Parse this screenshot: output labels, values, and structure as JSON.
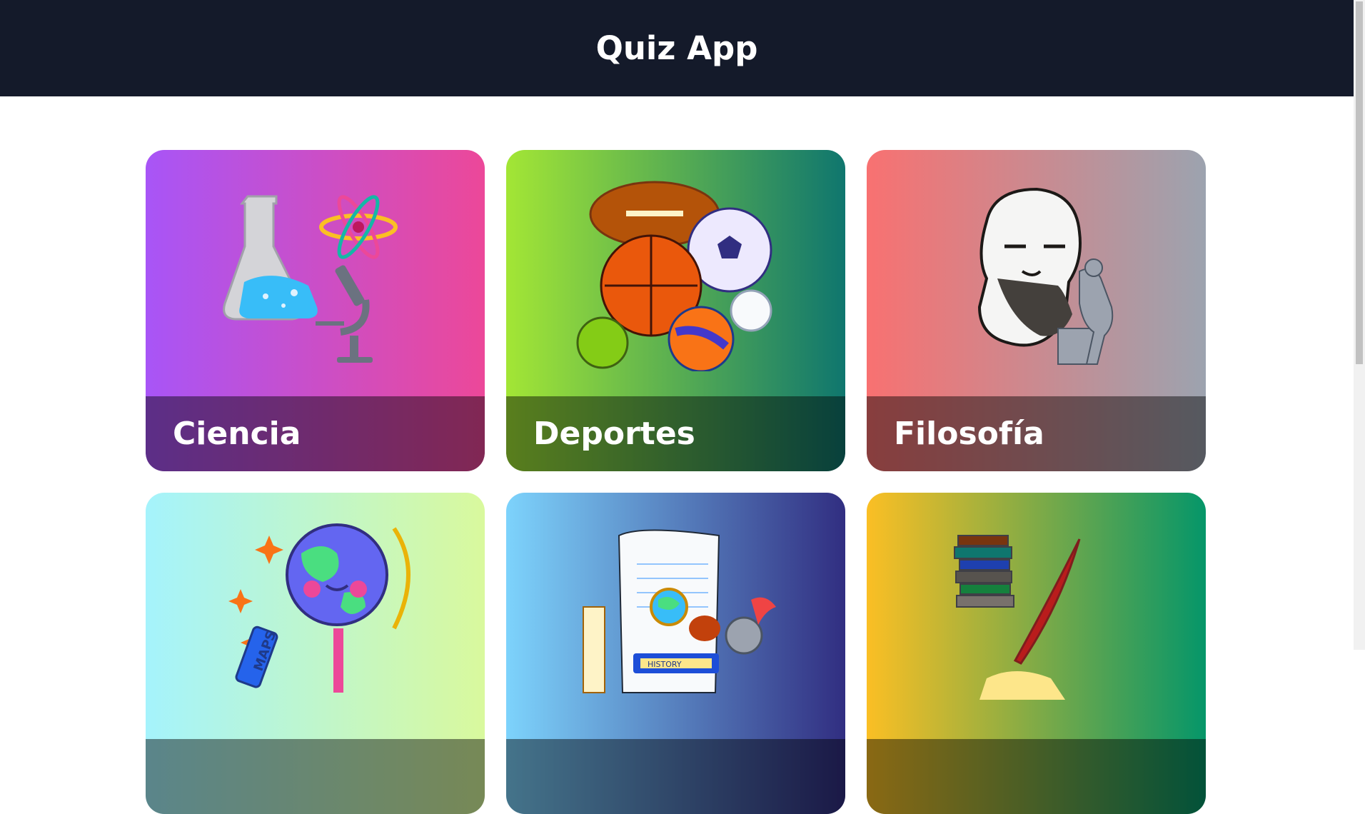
{
  "header": {
    "title": "Quiz App"
  },
  "categories": [
    {
      "label": "Ciencia",
      "icon": "science-illustration-icon"
    },
    {
      "label": "Deportes",
      "icon": "sports-balls-illustration-icon"
    },
    {
      "label": "Filosofía",
      "icon": "philosopher-thinker-illustration-icon"
    },
    {
      "label": "",
      "icon": "globe-map-illustration-icon"
    },
    {
      "label": "",
      "icon": "history-scroll-illustration-icon"
    },
    {
      "label": "",
      "icon": "books-quill-illustration-icon"
    }
  ]
}
